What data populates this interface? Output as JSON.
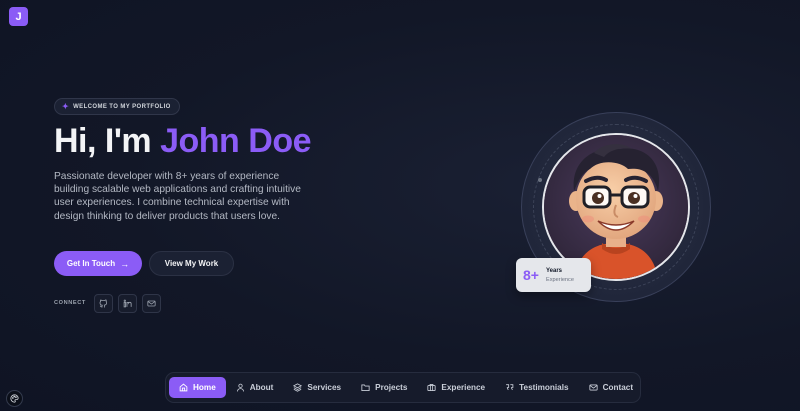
{
  "brand": {
    "logo_letter": "J",
    "accent": "#8b5cf6"
  },
  "hero": {
    "badge": "WELCOME TO MY PORTFOLIO",
    "greeting": "Hi, I'm ",
    "name": "John Doe",
    "intro": "Passionate developer with 8+ years of experience building scalable web applications and crafting intuitive user experiences. I combine technical expertise with design thinking to deliver products that users love.",
    "primary_button": "Get In Touch",
    "secondary_button": "View My Work",
    "connect_label": "CONNECT",
    "socials": [
      {
        "icon": "github-icon"
      },
      {
        "icon": "linkedin-icon"
      },
      {
        "icon": "mail-icon"
      }
    ]
  },
  "stats": {
    "value": "8+",
    "label": "Years",
    "sub": "Experience"
  },
  "nav": {
    "items": [
      {
        "label": "Home",
        "icon": "home-icon",
        "active": true
      },
      {
        "label": "About",
        "icon": "user-icon"
      },
      {
        "label": "Services",
        "icon": "layers-icon"
      },
      {
        "label": "Projects",
        "icon": "folder-icon"
      },
      {
        "label": "Experience",
        "icon": "briefcase-icon"
      },
      {
        "label": "Testimonials",
        "icon": "quote-icon"
      },
      {
        "label": "Contact",
        "icon": "mail-icon"
      }
    ]
  },
  "theme_toggle": {
    "icon": "palette-icon"
  }
}
